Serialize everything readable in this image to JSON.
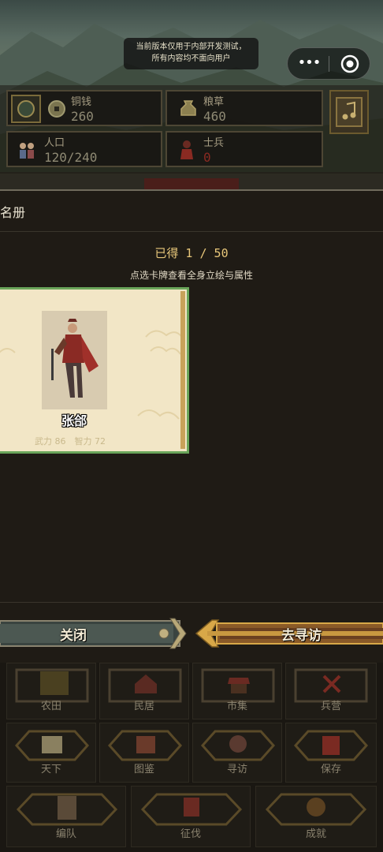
{
  "notice": {
    "line1": "当前版本仅用于内部开发测试，",
    "line2": "所有内容均不面向用户"
  },
  "capsule": {
    "more_icon": "•••"
  },
  "resources": [
    {
      "label": "铜钱",
      "value": "260"
    },
    {
      "label": "粮草",
      "value": "460"
    },
    {
      "label": "人口",
      "value": "120/240"
    },
    {
      "label": "士兵",
      "value": "0"
    }
  ],
  "modal": {
    "title": "名册",
    "collected": "已得 1 / 50",
    "hint": "点选卡牌查看全身立绘与属性",
    "card": {
      "name": "张郃",
      "stats": "武力 86　智力 72"
    },
    "close_label": "关闭",
    "visit_label": "去寻访"
  },
  "nav": [
    {
      "label": "农田"
    },
    {
      "label": "民居"
    },
    {
      "label": "市集"
    },
    {
      "label": "兵营"
    },
    {
      "label": "天下"
    },
    {
      "label": "图鉴"
    },
    {
      "label": "寻访"
    },
    {
      "label": "保存"
    },
    {
      "label": "编队"
    },
    {
      "label": "征伐"
    },
    {
      "label": "成就"
    }
  ],
  "colors": {
    "accent": "#e8c77a",
    "card_border": "#6aa55a",
    "button_gold": "#b88a3a"
  }
}
